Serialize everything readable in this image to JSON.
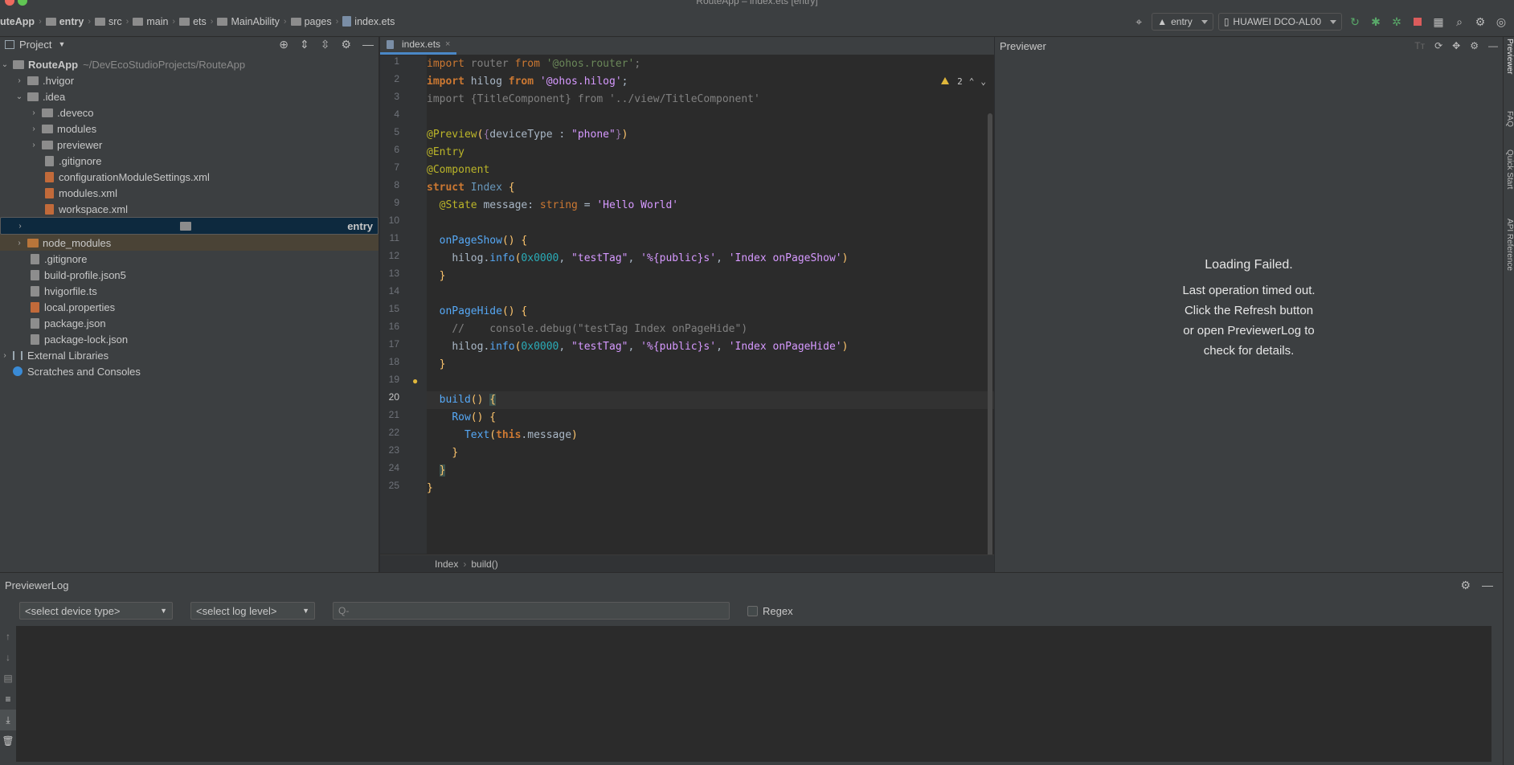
{
  "window": {
    "title": "RouteApp – index.ets [entry]"
  },
  "navbar": {
    "crumbs": [
      "uteApp",
      "entry",
      "src",
      "main",
      "ets",
      "MainAbility",
      "pages",
      "index.ets"
    ],
    "module_combo": "entry",
    "device_combo": "HUAWEI DCO-AL00"
  },
  "project": {
    "title": "Project",
    "tree": [
      {
        "label": "RouteApp",
        "hint": "~/DevEcoStudioProjects/RouteApp"
      },
      {
        "label": ".hvigor"
      },
      {
        "label": ".idea"
      },
      {
        "label": ".deveco"
      },
      {
        "label": "modules"
      },
      {
        "label": "previewer"
      },
      {
        "label": ".gitignore"
      },
      {
        "label": "configurationModuleSettings.xml"
      },
      {
        "label": "modules.xml"
      },
      {
        "label": "workspace.xml"
      },
      {
        "label": "entry"
      },
      {
        "label": "node_modules"
      },
      {
        "label": ".gitignore"
      },
      {
        "label": "build-profile.json5"
      },
      {
        "label": "hvigorfile.ts"
      },
      {
        "label": "local.properties"
      },
      {
        "label": "package.json"
      },
      {
        "label": "package-lock.json"
      },
      {
        "label": "External Libraries"
      },
      {
        "label": "Scratches and Consoles"
      }
    ]
  },
  "editor": {
    "tab": "index.ets",
    "warnings": "2",
    "line_numbers": [
      "1",
      "2",
      "3",
      "4",
      "5",
      "6",
      "7",
      "8",
      "9",
      "10",
      "11",
      "12",
      "13",
      "14",
      "15",
      "16",
      "17",
      "18",
      "19",
      "20",
      "21",
      "22",
      "23",
      "24",
      "25"
    ],
    "breadcrumb": [
      "Index",
      "build()"
    ]
  },
  "previewer": {
    "title": "Previewer",
    "heading": "Loading Failed.",
    "body": [
      "Last operation timed out.",
      "Click the Refresh button",
      "or open PreviewerLog to",
      "check for details."
    ]
  },
  "right_stripe": [
    "Previewer",
    "FAQ",
    "Quick Start",
    "API Reference"
  ],
  "log": {
    "title": "PreviewerLog",
    "device_select": "<select device type>",
    "level_select": "<select log level>",
    "search_placeholder": "Q-",
    "regex_label": "Regex"
  },
  "colors": {
    "accent": "#4a88c7",
    "selection": "#0d293e",
    "warning": "#e0b73b"
  }
}
